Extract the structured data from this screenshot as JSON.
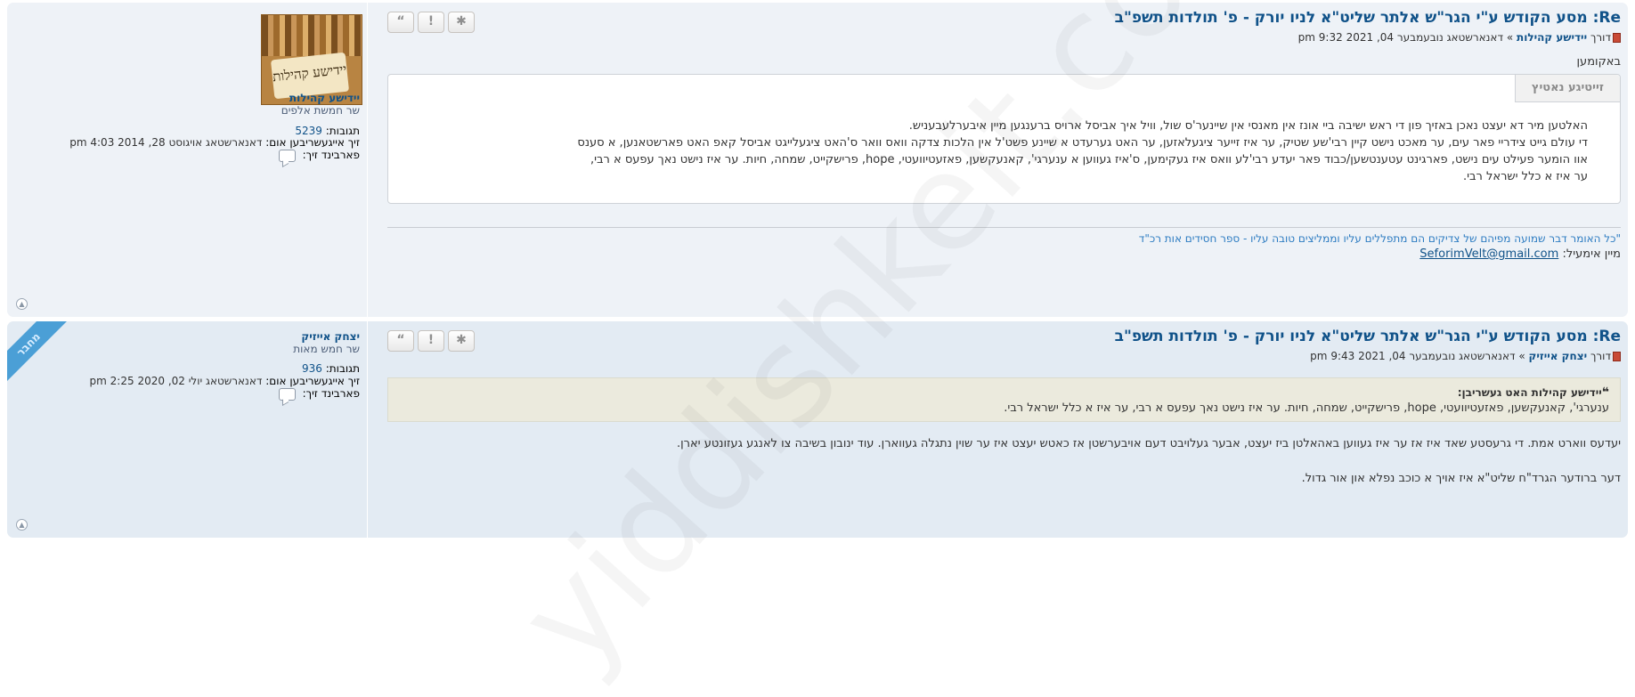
{
  "watermark": "yiddishkeit.com",
  "posts": [
    {
      "title": "Re: מסע הקודש ע\"י הגר\"ש אלתר שליט\"א לניו יורק - פ' תולדות תשפ\"ב",
      "meta": {
        "prefix": "דורך",
        "author": "יידישע קהילות",
        "sep": "»",
        "datetime": "דאנארשטאג נובעמבער 04, 2021 9:32 pm"
      },
      "buttons": [
        "“",
        "!",
        "✱"
      ],
      "profile": {
        "avatar_text": "יידישע קהילות",
        "username": "יידישע קהילות",
        "rank": "שר חמשת אלפים",
        "posts_label": "תגובות:",
        "posts_value": "5239",
        "joined_label": "זיך אייגעשריבען אום:",
        "joined_value": "דאנארשטאג אויגוסט 28, 2014 4:03 pm",
        "contact_label": "פארבינד זיך:"
      },
      "body_intro": "באקומען",
      "code_tab": "זייטיגע נאטיץ",
      "code_lines": [
        "האלטען מיר דא יעצט נאכן באזיך פון די ראש ישיבה ביי אונז אין מאנסי אין שיינער'ס שול, וויל איך אביסל ארויס ברענגען מיין איבערלעבעניש.",
        "די עולם גייט צידריי פאר עים, ער מאכט נישט קיין רבי'שע שטיק, ער איז זייער ציגעלאזען, ער האט גערעדט א שיינע פשט'ל אין הלכות צדקה וואס וואר ס'האט ציגעלייגט אביסל קאפ האט פארשטאנען, א סענס",
        "אוו הומער פעילט עים נישט, פארגינט עטענטשען/כבוד פאר יעדע רבי'לע וואס איז געקימען, ס'איז געווען א ענערגי', קאנעקשען, פאזעטיוועטי, hope, פרישקייט, שמחה, חיות. ער איז נישט נאך עפעס א רבי,",
        "ער איז א כלל ישראל רבי."
      ],
      "signature": {
        "quote": "\"כל האומר דבר שמועה מפיהם של צדיקים הם מתפללים עליו וממליצים טובה עליו - ספר חסידים אות רכ\"ד",
        "email_label": "מיין אימעיל:",
        "email": "SeforimVelt@gmail.com"
      }
    },
    {
      "title": "Re: מסע הקודש ע\"י הגר\"ש אלתר שליט\"א לניו יורק - פ' תולדות תשפ\"ב",
      "meta": {
        "prefix": "דורך",
        "author": "יצחק אייזיק",
        "sep": "»",
        "datetime": "דאנארשטאג נובעמבער 04, 2021 9:43 pm"
      },
      "buttons": [
        "“",
        "!",
        "✱"
      ],
      "profile": {
        "ribbon": "מחבר",
        "username": "יצחק אייזיק",
        "rank": "שר חמש מאות",
        "posts_label": "תגובות:",
        "posts_value": "936",
        "joined_label": "זיך אייגעשריבען אום:",
        "joined_value": "דאנארשטאג יולי 02, 2020 2:25 pm",
        "contact_label": "פארבינד זיך:"
      },
      "quote": {
        "cite": "יידישע קהילות האט געשריבן:",
        "text": "ענערגי', קאנעקשען, פאזעטיוועטי, hope, פרישקייט, שמחה, חיות. ער איז נישט נאך עפעס א רבי, ער איז א כלל ישראל רבי."
      },
      "body_lines": [
        "יעדעס ווארט אמת. די גרעסטע שאד איז אז ער איז געווען באהאלטן ביז יעצט, אבער געלויבט דעם אויבערשטן אז כאטש יעצט איז ער שוין נתגלה געווארן. עוד ינובון בשיבה צו לאנגע געזונטע יארן.",
        "דער ברודער הגרד\"ח שליט\"א איז אויך א כוכב נפלא און אור גדול."
      ]
    }
  ]
}
